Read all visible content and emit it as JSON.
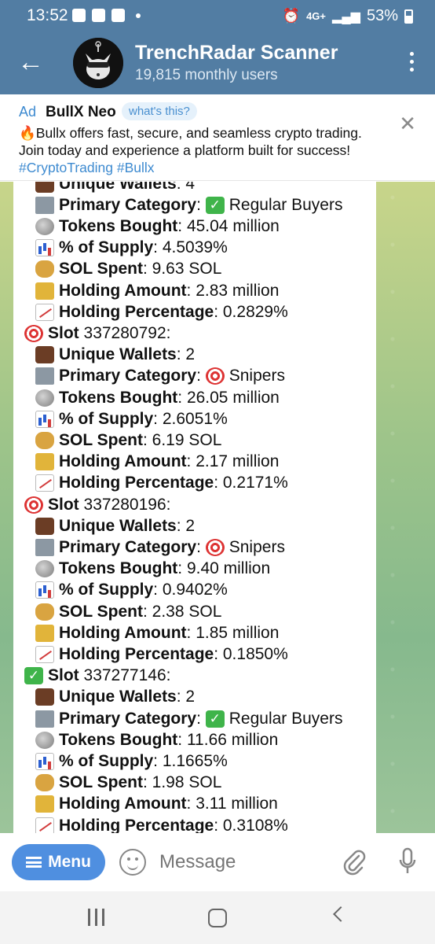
{
  "status": {
    "time": "13:52",
    "network": "4G+",
    "battery": "53%"
  },
  "header": {
    "title": "TrenchRadar Scanner",
    "subtitle": "19,815 monthly users"
  },
  "ad": {
    "label": "Ad",
    "title": "BullX Neo",
    "whats_this": "what's this?",
    "text_main": "Bullx offers fast, secure, and seamless crypto trading. Join today and experience a platform built for success!",
    "tag1": "#CryptoTrading",
    "tag2": "#Bullx"
  },
  "message_lines": [
    {
      "icon": "briefcase",
      "label": "Unique Wallets",
      "value": "4"
    },
    {
      "icon": "folder",
      "label": "Primary Category",
      "value": "Regular Buyers",
      "value_icon": "check"
    },
    {
      "icon": "coin",
      "label": "Tokens Bought",
      "value": "45.04 million"
    },
    {
      "icon": "chart",
      "label": "% of Supply",
      "value": "4.5039%"
    },
    {
      "icon": "money",
      "label": "SOL Spent",
      "value": "9.63 SOL"
    },
    {
      "icon": "lock",
      "label": "Holding Amount",
      "value": "2.83 million"
    },
    {
      "icon": "trend",
      "label": "Holding Percentage",
      "value": "0.2829%"
    },
    {
      "icon": "target",
      "label": "Slot",
      "value": "337280792:",
      "slot": true
    },
    {
      "icon": "briefcase",
      "label": "Unique Wallets",
      "value": "2"
    },
    {
      "icon": "folder",
      "label": "Primary Category",
      "value": "Snipers",
      "value_icon": "target"
    },
    {
      "icon": "coin",
      "label": "Tokens Bought",
      "value": "26.05 million"
    },
    {
      "icon": "chart",
      "label": "% of Supply",
      "value": "2.6051%"
    },
    {
      "icon": "money",
      "label": "SOL Spent",
      "value": "6.19 SOL"
    },
    {
      "icon": "lock",
      "label": "Holding Amount",
      "value": "2.17 million"
    },
    {
      "icon": "trend",
      "label": "Holding Percentage",
      "value": "0.2171%"
    },
    {
      "icon": "target",
      "label": "Slot",
      "value": "337280196:",
      "slot": true
    },
    {
      "icon": "briefcase",
      "label": "Unique Wallets",
      "value": "2"
    },
    {
      "icon": "folder",
      "label": "Primary Category",
      "value": "Snipers",
      "value_icon": "target"
    },
    {
      "icon": "coin",
      "label": "Tokens Bought",
      "value": "9.40 million"
    },
    {
      "icon": "chart",
      "label": "% of Supply",
      "value": "0.9402%"
    },
    {
      "icon": "money",
      "label": "SOL Spent",
      "value": "2.38 SOL"
    },
    {
      "icon": "lock",
      "label": "Holding Amount",
      "value": "1.85 million"
    },
    {
      "icon": "trend",
      "label": "Holding Percentage",
      "value": "0.1850%"
    },
    {
      "icon": "check",
      "label": "Slot",
      "value": "337277146:",
      "slot": true
    },
    {
      "icon": "briefcase",
      "label": "Unique Wallets",
      "value": "2"
    },
    {
      "icon": "folder",
      "label": "Primary Category",
      "value": "Regular Buyers",
      "value_icon": "check"
    },
    {
      "icon": "coin",
      "label": "Tokens Bought",
      "value": "11.66 million"
    },
    {
      "icon": "chart",
      "label": "% of Supply",
      "value": "1.1665%"
    },
    {
      "icon": "money",
      "label": "SOL Spent",
      "value": "1.98 SOL"
    },
    {
      "icon": "lock",
      "label": "Holding Amount",
      "value": "3.11 million"
    },
    {
      "icon": "trend",
      "label": "Holding Percentage",
      "value": "0.3108%"
    }
  ],
  "input": {
    "menu_label": "Menu",
    "placeholder": "Message"
  },
  "colors": {
    "header": "#527da3",
    "accent": "#4f8fe0",
    "link": "#3d8ad0"
  }
}
